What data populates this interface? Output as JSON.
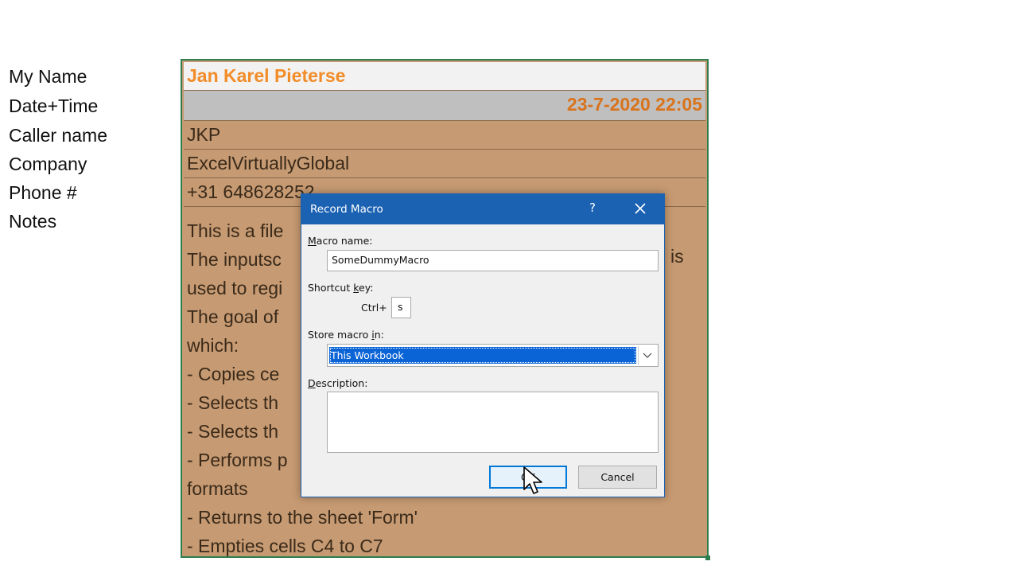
{
  "labels": {
    "my_name": "My Name",
    "date_time": "Date+Time",
    "caller_name": "Caller name",
    "company": "Company",
    "phone": "Phone #",
    "notes": "Notes"
  },
  "form": {
    "name_value": "Jan Karel Pieterse",
    "date_value": "23-7-2020 22:05",
    "caller_value": "JKP",
    "company_value": "ExcelVirtuallyGlobal",
    "phone_value": "+31 648628252",
    "notes_lines": [
      "This is a file",
      "The inputsc",
      "used to regi",
      "The goal of",
      "which:",
      "- Copies ce",
      "- Selects th",
      "- Selects th",
      "- Performs p",
      "formats",
      "- Returns to the sheet 'Form'",
      "- Empties cells C4 to C7"
    ],
    "notes_right_fragment": "is"
  },
  "dialog": {
    "title": "Record Macro",
    "help_label": "?",
    "macro_name_label_pre": "",
    "macro_name_label_key": "M",
    "macro_name_label_post": "acro name:",
    "macro_name_value": "SomeDummyMacro",
    "shortcut_label_pre": "Shortcut ",
    "shortcut_label_key": "k",
    "shortcut_label_post": "ey:",
    "ctrl_label": "Ctrl+",
    "shortcut_value": "s",
    "store_label_pre": "Store macro ",
    "store_label_key": "i",
    "store_label_post": "n:",
    "store_value": "This Workbook",
    "description_label_pre": "",
    "description_label_key": "D",
    "description_label_post": "escription:",
    "description_value": "",
    "ok_label": "OK",
    "cancel_label": "Cancel"
  },
  "colors": {
    "titlebar": "#1b62b3",
    "form_fill": "#c69a72",
    "name_color": "#f28c28",
    "date_color": "#d9731c",
    "selection": "#0a64d6"
  }
}
